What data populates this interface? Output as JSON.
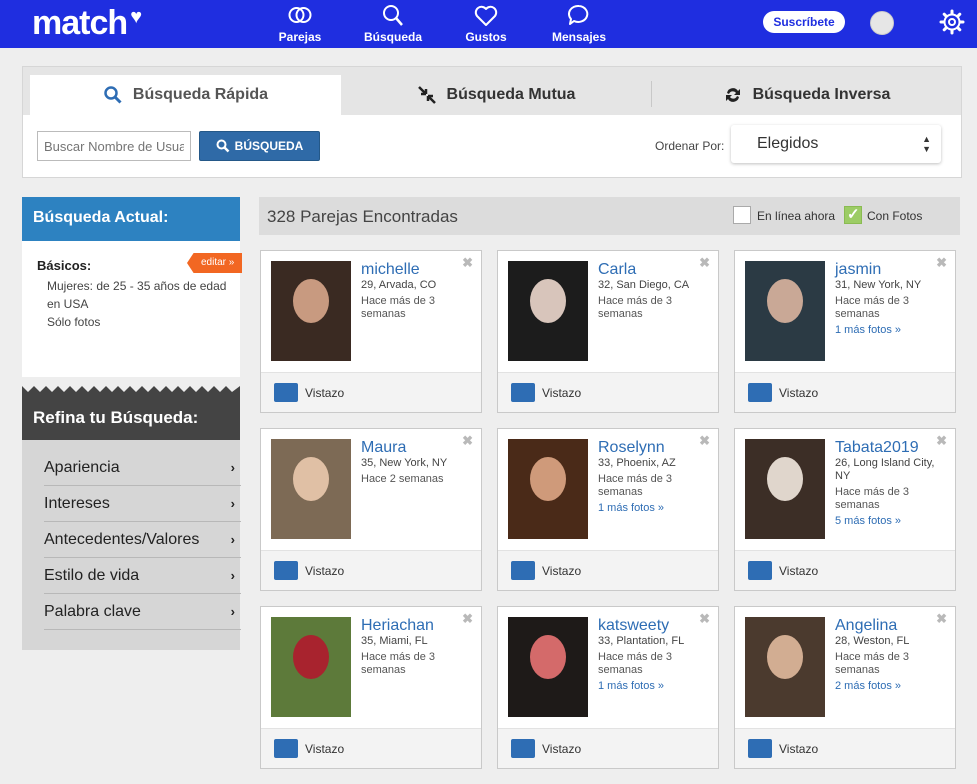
{
  "nav": {
    "logo": "match",
    "items": [
      {
        "label": "Parejas",
        "icon": "couples-icon"
      },
      {
        "label": "Búsqueda",
        "icon": "search-icon"
      },
      {
        "label": "Gustos",
        "icon": "heart-icon"
      },
      {
        "label": "Mensajes",
        "icon": "chat-icon"
      }
    ],
    "subscribe_label": "Suscríbete"
  },
  "search": {
    "tabs": [
      {
        "label": "Búsqueda Rápida",
        "icon": "search-icon",
        "active": true
      },
      {
        "label": "Búsqueda Mutua",
        "icon": "arrows-in-icon",
        "active": false
      },
      {
        "label": "Búsqueda Inversa",
        "icon": "reverse-icon",
        "active": false
      }
    ],
    "input_placeholder": "Buscar Nombre de Usuario",
    "button_label": "BÚSQUEDA",
    "sort_label": "Ordenar Por:",
    "sort_value": "Elegidos"
  },
  "current_search": {
    "title": "Búsqueda Actual:",
    "basics_label": "Básicos:",
    "edit_label": "editar »",
    "criteria": [
      "Mujeres: de 25 - 35 años de edad",
      "en USA",
      "Sólo fotos"
    ]
  },
  "refine": {
    "title": "Refina tu Búsqueda:",
    "items": [
      "Apariencia",
      "Intereses",
      "Antecedentes/Valores",
      "Estilo de vida",
      "Palabra clave"
    ]
  },
  "results": {
    "count_label": "328 Parejas Encontradas",
    "online_label": "En línea ahora",
    "online_checked": false,
    "photos_label": "Con Fotos",
    "photos_checked": true
  },
  "action_label": "Vistazo",
  "profiles": [
    {
      "name": "michelle",
      "location": "29, Arvada, CO",
      "active": "Hace más de 3 semanas",
      "more": "",
      "colors": [
        "#3a2a22",
        "#c89a80"
      ]
    },
    {
      "name": "Carla",
      "location": "32, San Diego, CA",
      "active": "Hace más de 3 semanas",
      "more": "",
      "colors": [
        "#1c1c1c",
        "#d8c5bb"
      ]
    },
    {
      "name": "jasmin",
      "location": "31, New York, NY",
      "active": "Hace más de 3 semanas",
      "more": "1 más fotos »",
      "colors": [
        "#2b3a44",
        "#c9a896"
      ]
    },
    {
      "name": "Maura",
      "location": "35, New York, NY",
      "active": "Hace 2 semanas",
      "more": "",
      "colors": [
        "#7d6a55",
        "#e0c0a5"
      ]
    },
    {
      "name": "Roselynn",
      "location": "33, Phoenix, AZ",
      "active": "Hace más de 3 semanas",
      "more": "1 más fotos »",
      "colors": [
        "#4a2a18",
        "#cf9a7a"
      ]
    },
    {
      "name": "Tabata2019",
      "location": "26, Long Island City, NY",
      "active": "Hace más de 3 semanas",
      "more": "5 más fotos »",
      "colors": [
        "#3c2e26",
        "#e0d6cc"
      ]
    },
    {
      "name": "Heriachan",
      "location": "35, Miami, FL",
      "active": "Hace más de 3 semanas",
      "more": "",
      "colors": [
        "#5d7a3a",
        "#a8232e"
      ]
    },
    {
      "name": "katsweety",
      "location": "33, Plantation, FL",
      "active": "Hace más de 3 semanas",
      "more": "1 más fotos »",
      "colors": [
        "#1e1a18",
        "#d46a6a"
      ]
    },
    {
      "name": "Angelina",
      "location": "28, Weston, FL",
      "active": "Hace más de 3 semanas",
      "more": "2 más fotos »",
      "colors": [
        "#4b3a2e",
        "#d2ad92"
      ]
    }
  ],
  "colors": {
    "brand_blue": "#1f2ee0",
    "link_blue": "#2e6db4",
    "header_blue": "#2d82c1",
    "accent_orange": "#f26722",
    "check_green": "#9ccc65"
  }
}
